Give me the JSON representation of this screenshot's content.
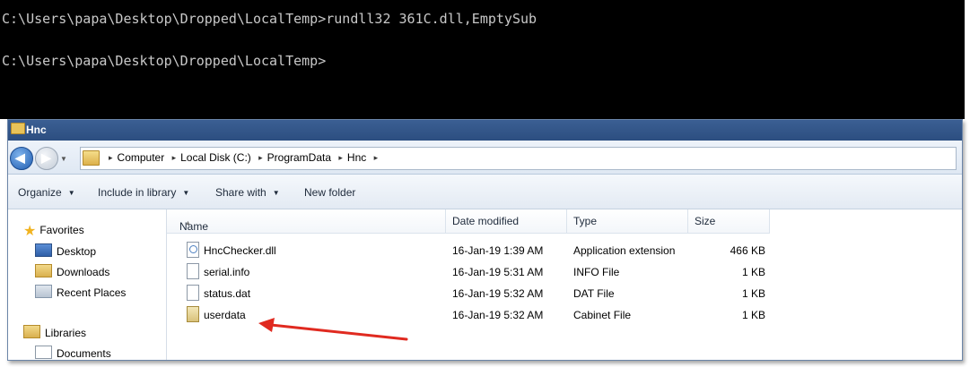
{
  "console": {
    "lines": [
      "C:\\Users\\papa\\Desktop\\Dropped\\LocalTemp>rundll32 361C.dll,EmptySub",
      "C:\\Users\\papa\\Desktop\\Dropped\\LocalTemp>"
    ]
  },
  "window": {
    "title": "Hnc",
    "breadcrumbs": [
      "Computer",
      "Local Disk (C:)",
      "ProgramData",
      "Hnc"
    ]
  },
  "toolbar": {
    "organize": "Organize",
    "include_in_library": "Include in library",
    "share_with": "Share with",
    "new_folder": "New folder"
  },
  "navpane": {
    "favorites": "Favorites",
    "desktop": "Desktop",
    "downloads": "Downloads",
    "recent_places": "Recent Places",
    "libraries": "Libraries",
    "documents": "Documents"
  },
  "columns": {
    "name": "Name",
    "date_modified": "Date modified",
    "type": "Type",
    "size": "Size"
  },
  "files": [
    {
      "name": "HncChecker.dll",
      "date": "16-Jan-19 1:39 AM",
      "type": "Application extension",
      "size": "466 KB",
      "icon": "dll-file-icon"
    },
    {
      "name": "serial.info",
      "date": "16-Jan-19 5:31 AM",
      "type": "INFO File",
      "size": "1 KB",
      "icon": "file-icon"
    },
    {
      "name": "status.dat",
      "date": "16-Jan-19 5:32 AM",
      "type": "DAT File",
      "size": "1 KB",
      "icon": "file-icon"
    },
    {
      "name": "userdata",
      "date": "16-Jan-19 5:32 AM",
      "type": "Cabinet File",
      "size": "1 KB",
      "icon": "cabinet-file-icon"
    }
  ],
  "annotation": {
    "color": "#e02a20",
    "target": "userdata"
  }
}
